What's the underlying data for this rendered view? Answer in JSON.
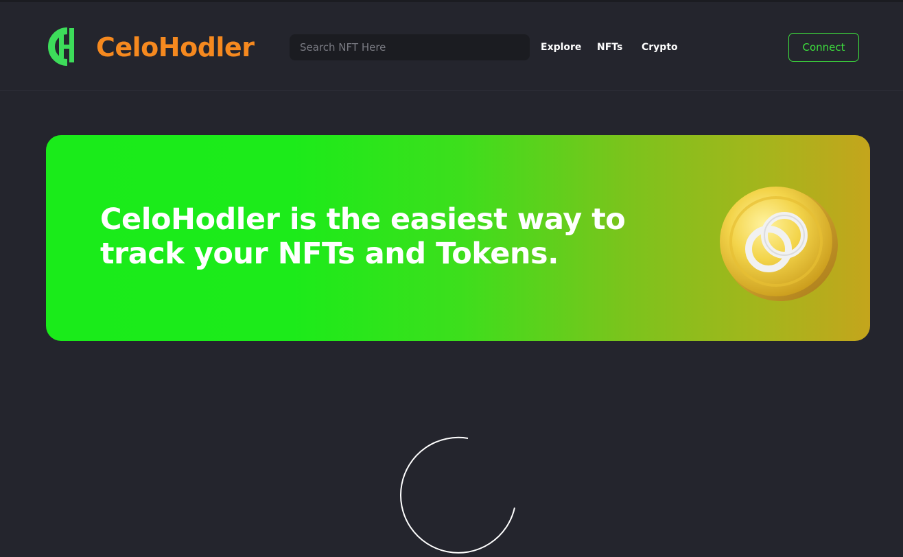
{
  "app": {
    "brand_name": "CeloHodler",
    "brand_color": "#f5891f",
    "logo_color": "#3ddc5a"
  },
  "header": {
    "search": {
      "placeholder": "Search NFT Here",
      "value": ""
    },
    "nav": [
      {
        "label": "Explore"
      },
      {
        "label": "NFTs"
      },
      {
        "label": "Crypto"
      }
    ],
    "connect_label": "Connect",
    "accent": "#3ddc3d"
  },
  "hero": {
    "title": "CeloHodler is the easiest way to track your NFTs and Tokens.",
    "coin_icon": "celo-coin-icon",
    "gradient": [
      "#1aeb1a",
      "#c4a51c"
    ]
  },
  "loading": {
    "icon": "loading-spinner-icon"
  }
}
